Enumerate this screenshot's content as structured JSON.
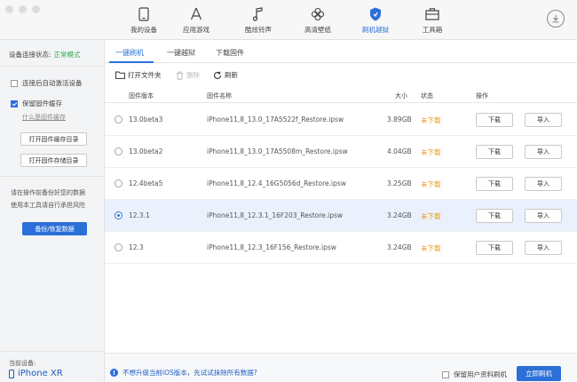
{
  "nav": {
    "items": [
      {
        "label": "我的设备",
        "icon": "tablet-icon"
      },
      {
        "label": "应用游戏",
        "icon": "app-store-icon"
      },
      {
        "label": "酷炫铃声",
        "icon": "music-note-icon"
      },
      {
        "label": "高清壁纸",
        "icon": "flower-icon"
      },
      {
        "label": "刷机越狱",
        "icon": "shield-icon"
      },
      {
        "label": "工具箱",
        "icon": "toolbox-icon"
      }
    ],
    "active_index": 4
  },
  "sidebar": {
    "status_label": "设备连接状态:",
    "status_value": "正常模式",
    "auto_activate_label": "连接后自动激活设备",
    "auto_activate_checked": false,
    "keep_cache_label": "保留固件缓存",
    "keep_cache_checked": true,
    "what_is_cache": "什么是固件缓存",
    "open_cache_dir": "打开固件缓存目录",
    "open_storage_dir": "打开固件存储目录",
    "note_line1": "请在操作前备份好您的数据",
    "note_line2": "使用本工具请自行承担风险",
    "backup_button": "备份/恢复数据",
    "device_label": "当前设备:",
    "device_name": "iPhone XR"
  },
  "tabs": [
    "一键刷机",
    "一键越狱",
    "下载固件"
  ],
  "toolbar": {
    "open_folder": "打开文件夹",
    "delete": "删除",
    "refresh": "刷新"
  },
  "table": {
    "headers": {
      "version": "固件版本",
      "name": "固件名称",
      "size": "大小",
      "status": "状态",
      "action": "操作"
    },
    "rows": [
      {
        "version": "13.0beta3",
        "name": "iPhone11,8_13.0_17A5522f_Restore.ipsw",
        "size": "3.89GB",
        "status": "未下载",
        "download": "下载",
        "import": "导入",
        "selected": false
      },
      {
        "version": "13.0beta2",
        "name": "iPhone11,8_13.0_17A5508m_Restore.ipsw",
        "size": "4.04GB",
        "status": "未下载",
        "download": "下载",
        "import": "导入",
        "selected": false
      },
      {
        "version": "12.4beta5",
        "name": "iPhone11,8_12.4_16G5056d_Restore.ipsw",
        "size": "3.25GB",
        "status": "未下载",
        "download": "下载",
        "import": "导入",
        "selected": false
      },
      {
        "version": "12.3.1",
        "name": "iPhone11,8_12.3.1_16F203_Restore.ipsw",
        "size": "3.24GB",
        "status": "未下载",
        "download": "下载",
        "import": "导入",
        "selected": true
      },
      {
        "version": "12.3",
        "name": "iPhone11,8_12.3_16F156_Restore.ipsw",
        "size": "3.24GB",
        "status": "未下载",
        "download": "下载",
        "import": "导入",
        "selected": false
      }
    ]
  },
  "footer": {
    "warning": "不想升级当前iOS版本，先试试抹除所有数据?",
    "keep_data_label": "保留用户资料刷机",
    "flash_button": "立即刷机"
  },
  "colors": {
    "accent": "#2b6fd8",
    "status_pending": "#e79b1e",
    "ok": "#2bae4a"
  }
}
